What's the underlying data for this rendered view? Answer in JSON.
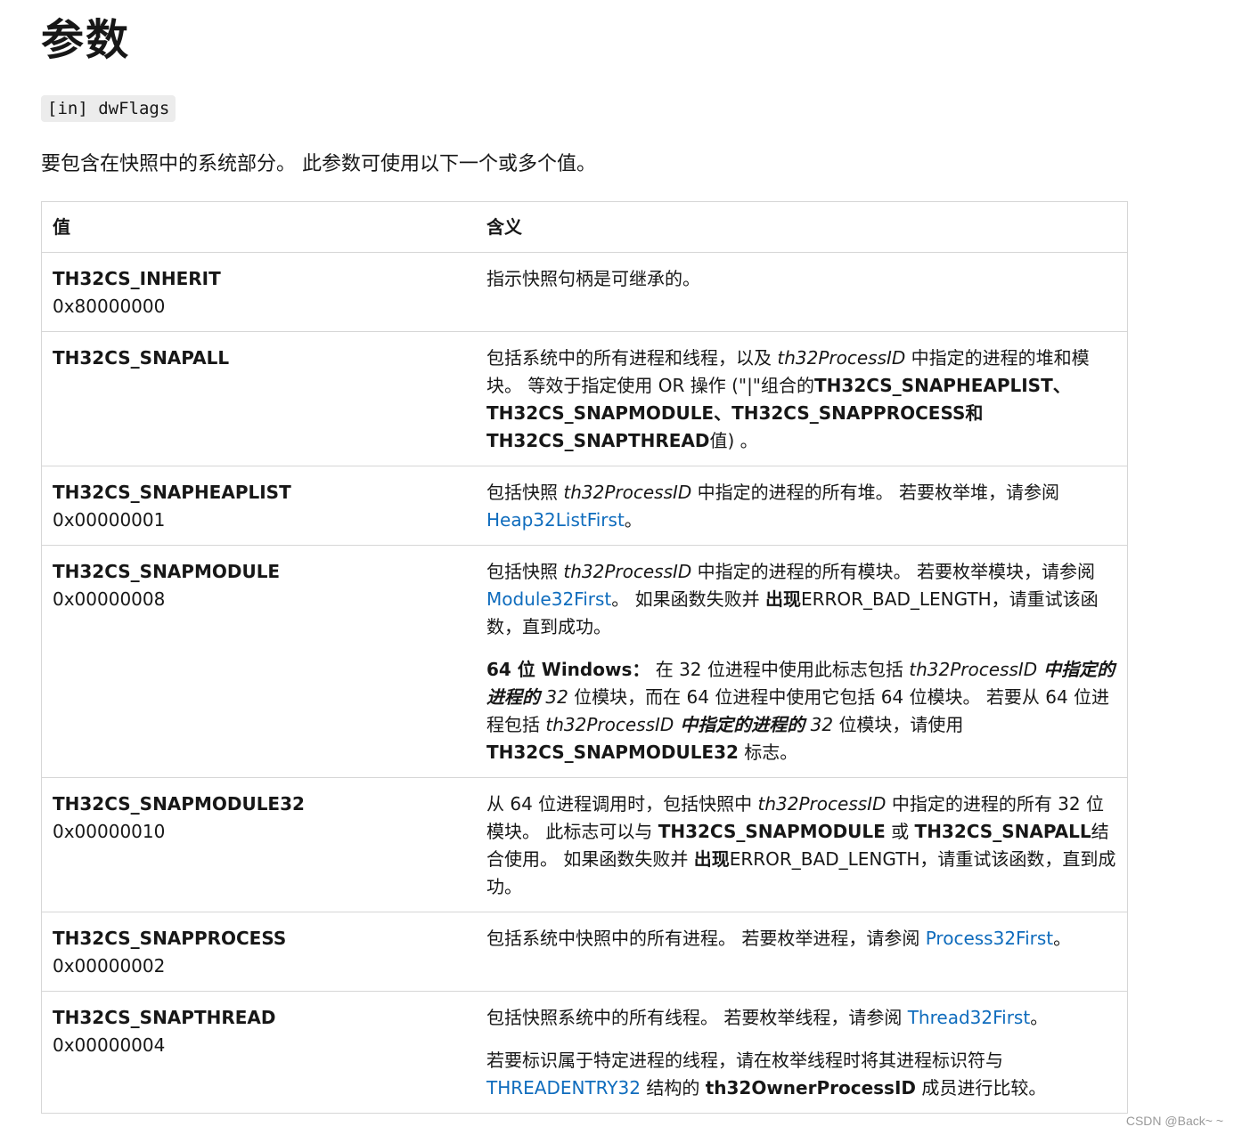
{
  "heading": "参数",
  "param": "[in] dwFlags",
  "intro": "要包含在快照中的系统部分。 此参数可使用以下一个或多个值。",
  "table": {
    "col_value": "值",
    "col_meaning": "含义",
    "rows": [
      {
        "flag": "TH32CS_INHERIT",
        "hex": "0x80000000",
        "p1": "指示快照句柄是可继承的。"
      },
      {
        "flag": "TH32CS_SNAPALL",
        "hex": "",
        "p1a": "包括系统中的所有进程和线程，以及 ",
        "p1b": "th32ProcessID",
        "p1c": " 中指定的进程的堆和模块。 等效于指定使用 OR 操作 (\"|\"组合的",
        "p1d": "TH32CS_SNAPHEAPLIST、TH32CS_SNAPMODULE、TH32CS_SNAPPROCESS和TH32CS_SNAPTHREAD",
        "p1e": "值) 。"
      },
      {
        "flag": "TH32CS_SNAPHEAPLIST",
        "hex": "0x00000001",
        "p1a": "包括快照 ",
        "p1b": "th32ProcessID",
        "p1c": " 中指定的进程的所有堆。 若要枚举堆，请参阅 ",
        "link": "Heap32ListFirst",
        "p1d": "。"
      },
      {
        "flag": "TH32CS_SNAPMODULE",
        "hex": "0x00000008",
        "p1a": "包括快照 ",
        "p1b": "th32ProcessID",
        "p1c": " 中指定的进程的所有模块。 若要枚举模块，请参阅 ",
        "link": "Module32First",
        "p1d": "。 如果函数失败并 ",
        "p1e": "出现",
        "p1f": "ERROR_BAD_LENGTH，请重试该函数，直到成功。",
        "p2a": "64 位 Windows：",
        "p2b": " 在 32 位进程中使用此标志包括 ",
        "p2c": "th32ProcessID",
        "p2d": " 中指定的进程的",
        "p2e": " 32 ",
        "p2f": "位模块，而在 64 位进程中使用它包括 64 位模块。 若要从 64 位进程包括 ",
        "p2g": "th32ProcessID",
        "p2h": " 中指定的进程的",
        "p2i": " 32 ",
        "p2j": "位模块，请使用 ",
        "p2k": "TH32CS_SNAPMODULE32",
        "p2l": " 标志。"
      },
      {
        "flag": "TH32CS_SNAPMODULE32",
        "hex": "0x00000010",
        "p1a": "从 64 位进程调用时，包括快照中 ",
        "p1b": "th32ProcessID",
        "p1c": " 中指定的进程的所有 32 位模块。 此标志可以与 ",
        "p1d": "TH32CS_SNAPMODULE",
        "p1e": " 或 ",
        "p1f": "TH32CS_SNAPALL",
        "p1g": "结合使用。 如果函数失败并 ",
        "p1h": "出现",
        "p1i": "ERROR_BAD_LENGTH，请重试该函数，直到成功。"
      },
      {
        "flag": "TH32CS_SNAPPROCESS",
        "hex": "0x00000002",
        "p1a": "包括系统中快照中的所有进程。 若要枚举进程，请参阅 ",
        "link": "Process32First",
        "p1b": "。"
      },
      {
        "flag": "TH32CS_SNAPTHREAD",
        "hex": "0x00000004",
        "p1a": "包括快照系统中的所有线程。 若要枚举线程，请参阅 ",
        "link": "Thread32First",
        "p1b": "。",
        "p2a": "若要标识属于特定进程的线程，请在枚举线程时将其进程标识符与 ",
        "link2": "THREADENTRY32",
        "p2b": " 结构的 ",
        "p2c": "th32OwnerProcessID",
        "p2d": " 成员进行比较。"
      }
    ]
  },
  "watermark": "CSDN @Back~ ~",
  "colors": {
    "link": "#0f6cbd",
    "code_bg": "#ececec",
    "border": "#d6d6d6"
  }
}
